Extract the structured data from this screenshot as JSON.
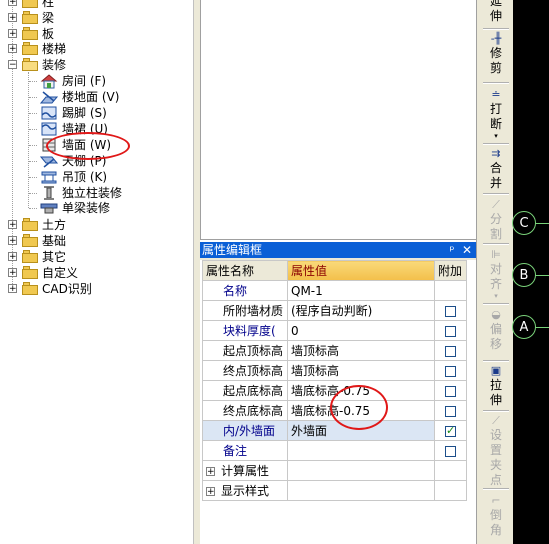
{
  "tree": {
    "items": [
      {
        "label": "柱"
      },
      {
        "label": "梁"
      },
      {
        "label": "板"
      },
      {
        "label": "楼梯"
      },
      {
        "label": "装修"
      },
      {
        "label": "房间 (F)"
      },
      {
        "label": "楼地面 (V)"
      },
      {
        "label": "踢脚 (S)"
      },
      {
        "label": "墙裙 (U)"
      },
      {
        "label": "墙面 (W)"
      },
      {
        "label": "天棚 (P)"
      },
      {
        "label": "吊顶 (K)"
      },
      {
        "label": "独立柱装修"
      },
      {
        "label": "单梁装修"
      },
      {
        "label": "土方"
      },
      {
        "label": "基础"
      },
      {
        "label": "其它"
      },
      {
        "label": "自定义"
      },
      {
        "label": "CAD识别"
      }
    ]
  },
  "property_panel": {
    "title": "属性编辑框",
    "pin_icon": "pin-icon",
    "close_icon": "close-icon",
    "headers": {
      "name": "属性名称",
      "value": "属性值",
      "extra": "附加"
    },
    "rows": [
      {
        "name": "名称",
        "value": "QM-1",
        "checkbox": null
      },
      {
        "name": "所附墙材质",
        "value": "(程序自动判断)",
        "checkbox": false
      },
      {
        "name": "块料厚度(",
        "value": "0",
        "checkbox": false
      },
      {
        "name": "起点顶标高",
        "value": "墙顶标高",
        "checkbox": false
      },
      {
        "name": "终点顶标高",
        "value": "墙顶标高",
        "checkbox": false
      },
      {
        "name": "起点底标高",
        "value": "墙底标高-0.75",
        "checkbox": false
      },
      {
        "name": "终点底标高",
        "value": "墙底标高-0.75",
        "checkbox": false
      },
      {
        "name": "内/外墙面",
        "value": "外墙面",
        "checkbox": true
      },
      {
        "name": "备注",
        "value": "",
        "checkbox": false
      }
    ],
    "groups": [
      {
        "label": "计算属性"
      },
      {
        "label": "显示样式"
      }
    ]
  },
  "toolbar": {
    "items": [
      {
        "label": "延伸",
        "icon": "extend-icon",
        "enabled": true
      },
      {
        "label": "修剪",
        "icon": "trim-icon",
        "enabled": true
      },
      {
        "label": "打断",
        "icon": "break-icon",
        "enabled": true
      },
      {
        "label": "合并",
        "icon": "merge-icon",
        "enabled": true
      },
      {
        "label": "分割",
        "icon": "split-icon",
        "enabled": false
      },
      {
        "label": "对齐",
        "icon": "align-icon",
        "enabled": false
      },
      {
        "label": "偏移",
        "icon": "offset-icon",
        "enabled": false
      },
      {
        "label": "拉伸",
        "icon": "stretch-icon",
        "enabled": true
      },
      {
        "label": "设置夹点",
        "icon": "grip-icon",
        "enabled": false
      },
      {
        "label": "倒角",
        "icon": "chamfer-icon",
        "enabled": false
      }
    ]
  },
  "axis_labels": [
    "C",
    "B",
    "A"
  ],
  "colors": {
    "title_bar": "#0a5fd6",
    "header_value_bg": "#f3bf4a",
    "annotation_red": "#e01818",
    "axis_green": "#7ad27a"
  }
}
